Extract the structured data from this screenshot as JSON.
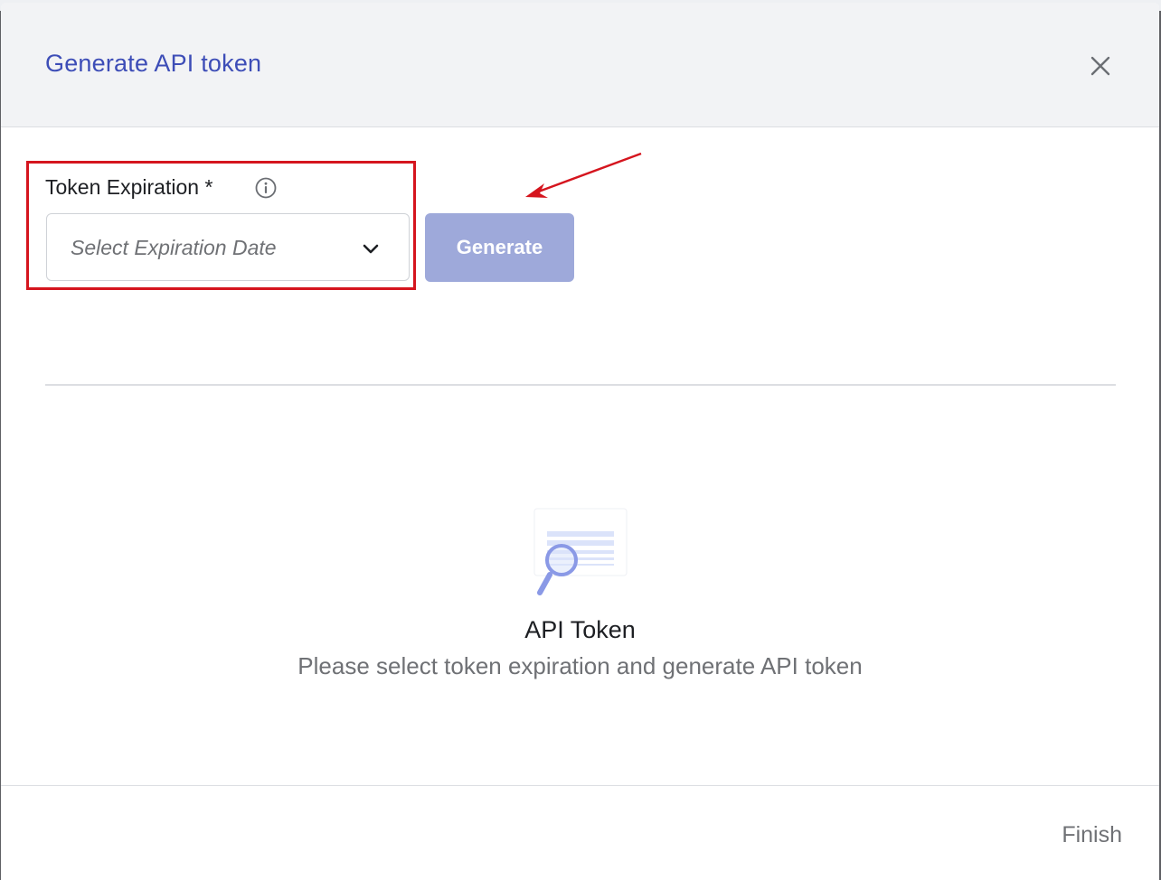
{
  "modal": {
    "title": "Generate API token",
    "close_icon": "close-icon"
  },
  "form": {
    "label": "Token Expiration",
    "required_marker": "*",
    "info_icon": "info-icon",
    "select_placeholder": "Select Expiration Date",
    "chevron_icon": "chevron-down-icon",
    "generate_label": "Generate",
    "generate_enabled": false
  },
  "empty_state": {
    "illustration_icon": "document-search-icon",
    "title": "API Token",
    "subtitle": "Please select token expiration and generate API token"
  },
  "footer": {
    "finish_label": "Finish"
  },
  "colors": {
    "title_accent": "#3d4db7",
    "generate_disabled_bg": "#9ea9da",
    "annotation_red": "#d5151e",
    "header_bg": "#f2f3f5"
  }
}
